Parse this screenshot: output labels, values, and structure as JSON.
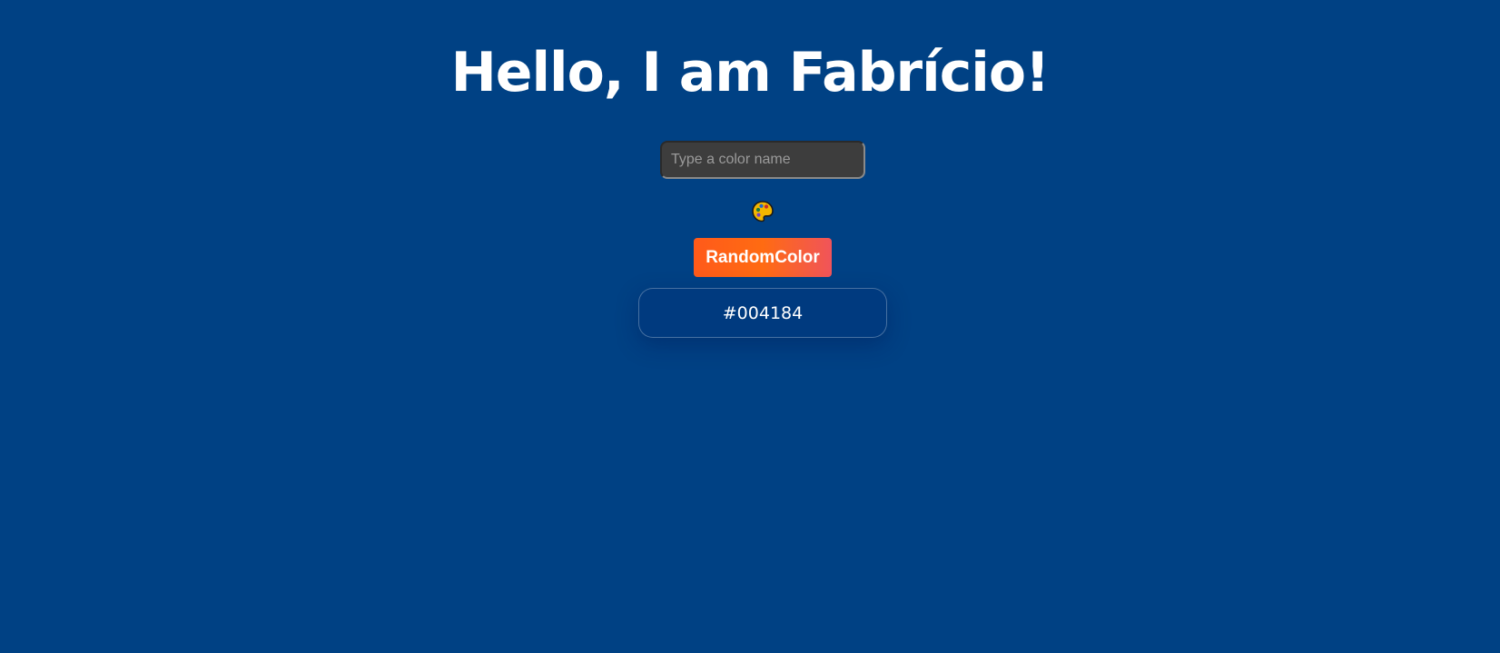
{
  "header": {
    "title": "Hello, I am Fabrício!"
  },
  "color_input": {
    "placeholder": "Type a color name",
    "value": ""
  },
  "palette_icon": {
    "icon": "palette-icon"
  },
  "random_button": {
    "label": "RandomColor"
  },
  "hex_display": {
    "value": "#004184"
  },
  "colors": {
    "background": "#004184",
    "button_gradient_start": "#ff5a1a",
    "button_gradient_end": "#f0545a",
    "input_background": "#3d3d3d",
    "text": "#ffffff"
  }
}
